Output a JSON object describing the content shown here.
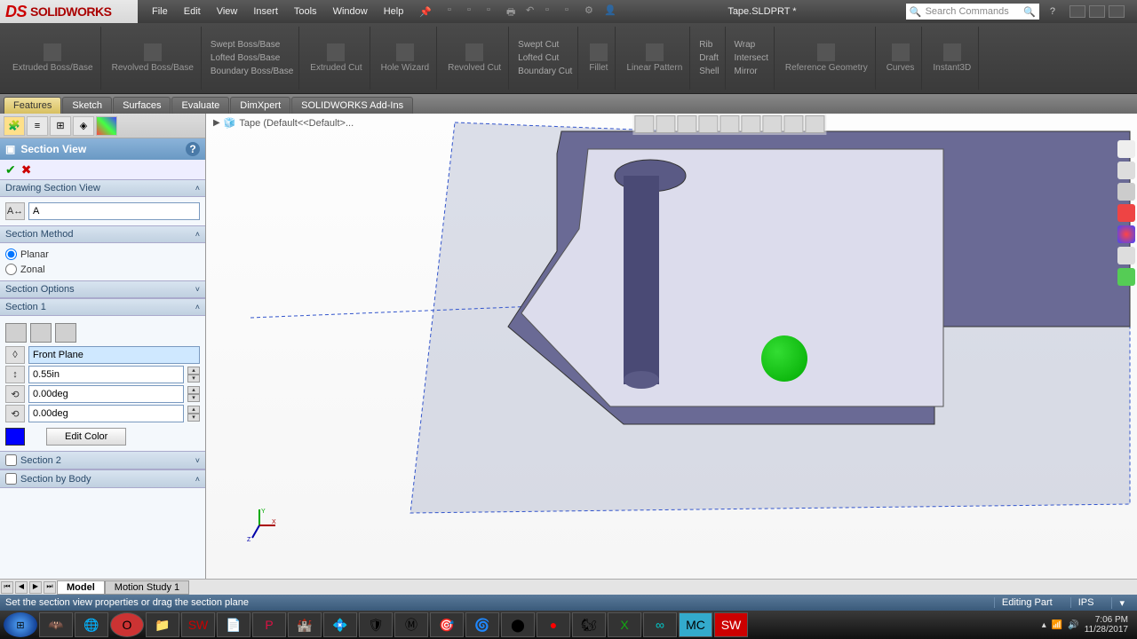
{
  "app": {
    "name": "SOLIDWORKS",
    "doc": "Tape.SLDPRT *",
    "search_placeholder": "Search Commands"
  },
  "menu": [
    "File",
    "Edit",
    "View",
    "Insert",
    "Tools",
    "Window",
    "Help"
  ],
  "ribbon": {
    "extruded_boss": "Extruded Boss/Base",
    "revolved_boss": "Revolved Boss/Base",
    "swept_boss": "Swept Boss/Base",
    "lofted_boss": "Lofted Boss/Base",
    "boundary_boss": "Boundary Boss/Base",
    "extruded_cut": "Extruded Cut",
    "hole_wizard": "Hole Wizard",
    "revolved_cut": "Revolved Cut",
    "swept_cut": "Swept Cut",
    "lofted_cut": "Lofted Cut",
    "boundary_cut": "Boundary Cut",
    "fillet": "Fillet",
    "linear_pattern": "Linear Pattern",
    "rib": "Rib",
    "draft": "Draft",
    "shell": "Shell",
    "wrap": "Wrap",
    "intersect": "Intersect",
    "mirror": "Mirror",
    "ref_geom": "Reference Geometry",
    "curves": "Curves",
    "instant3d": "Instant3D"
  },
  "tabs": [
    "Features",
    "Sketch",
    "Surfaces",
    "Evaluate",
    "DimXpert",
    "SOLIDWORKS Add-Ins"
  ],
  "panel": {
    "title": "Section View",
    "drawing_section": "Drawing Section View",
    "drawing_value": "A",
    "method_head": "Section Method",
    "method_planar": "Planar",
    "method_zonal": "Zonal",
    "options_head": "Section Options",
    "section1_head": "Section 1",
    "plane": "Front Plane",
    "offset": "0.55in",
    "rot1": "0.00deg",
    "rot2": "0.00deg",
    "edit_color": "Edit Color",
    "section2_head": "Section 2",
    "section_body_head": "Section by Body"
  },
  "breadcrumb": "Tape  (Default<<Default>...",
  "bottom_tabs": {
    "model": "Model",
    "motion": "Motion Study 1"
  },
  "status": {
    "hint": "Set the section view properties or drag the section plane",
    "mode": "Editing Part",
    "units": "IPS"
  },
  "tray": {
    "time": "7:06 PM",
    "date": "11/28/2017"
  }
}
